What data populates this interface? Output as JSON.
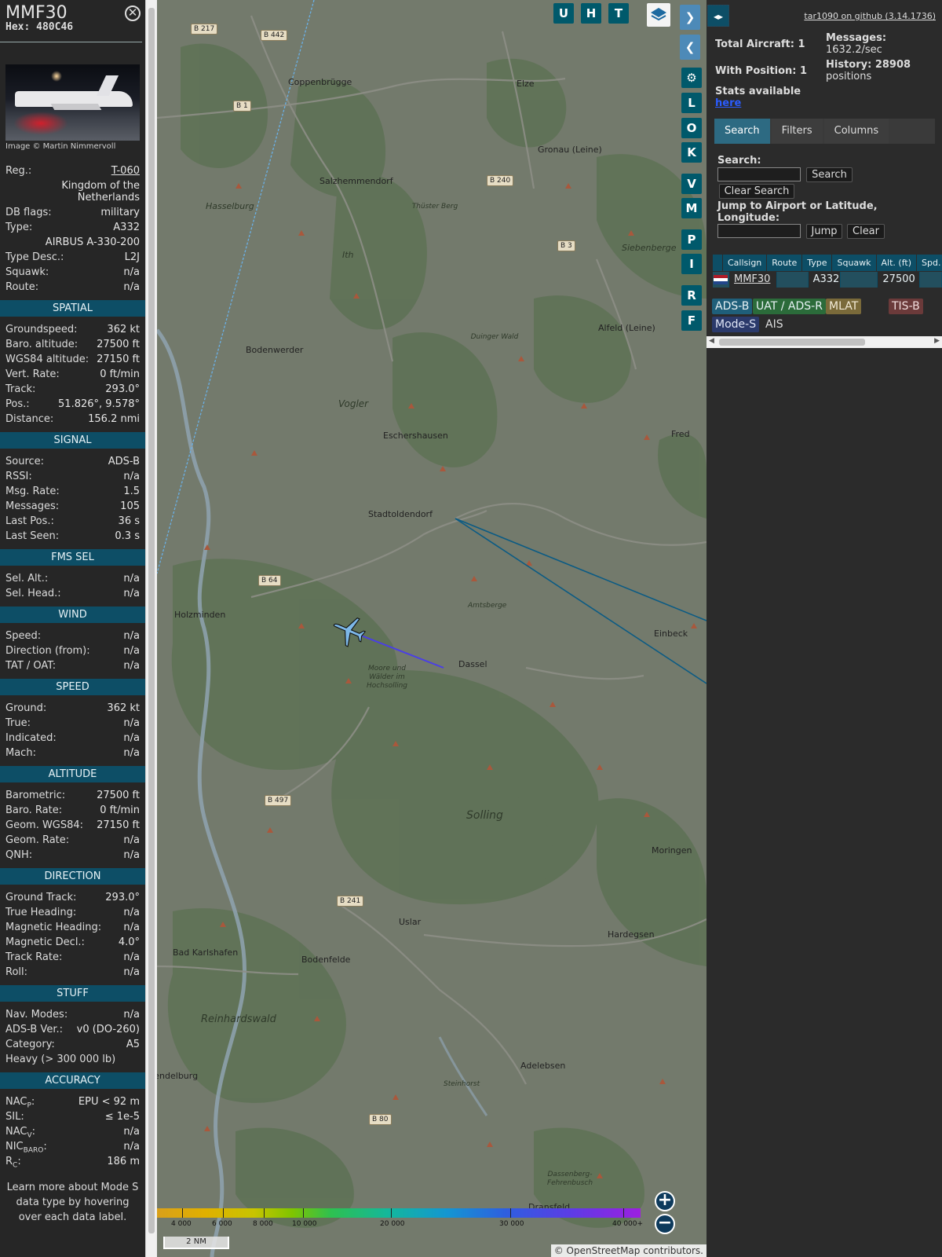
{
  "sidebar": {
    "callsign": "MMF30",
    "hex": "Hex: 480C46",
    "image_credit": "Image © Martin Nimmervoll",
    "info": [
      {
        "k": "Reg.:",
        "v": "T-060",
        "link": true
      },
      {
        "k": "",
        "v": "Kingdom of the Netherlands",
        "tall": true
      },
      {
        "k": "DB flags:",
        "v": "military"
      },
      {
        "k": "Type:",
        "v": "A332"
      },
      {
        "k": "",
        "v": "AIRBUS A-330-200"
      },
      {
        "k": "Type Desc.:",
        "v": "L2J"
      },
      {
        "k": "Squawk:",
        "v": "n/a"
      },
      {
        "k": "Route:",
        "v": "n/a"
      }
    ],
    "sections": [
      {
        "title": "SPATIAL",
        "rows": [
          {
            "k": "Groundspeed:",
            "v": "362 kt"
          },
          {
            "k": "Baro. altitude:",
            "v": "27500 ft"
          },
          {
            "k": "WGS84 altitude:",
            "v": "27150 ft"
          },
          {
            "k": "Vert. Rate:",
            "v": "0 ft/min"
          },
          {
            "k": "Track:",
            "v": "293.0°"
          },
          {
            "k": "Pos.:",
            "v": "51.826°, 9.578°"
          },
          {
            "k": "Distance:",
            "v": "156.2 nmi"
          }
        ]
      },
      {
        "title": "SIGNAL",
        "rows": [
          {
            "k": "Source:",
            "v": "ADS-B"
          },
          {
            "k": "RSSI:",
            "v": "n/a"
          },
          {
            "k": "Msg. Rate:",
            "v": "1.5"
          },
          {
            "k": "Messages:",
            "v": "105"
          },
          {
            "k": "Last Pos.:",
            "v": "36 s"
          },
          {
            "k": "Last Seen:",
            "v": "0.3 s"
          }
        ]
      },
      {
        "title": "FMS SEL",
        "rows": [
          {
            "k": "Sel. Alt.:",
            "v": "n/a"
          },
          {
            "k": "Sel. Head.:",
            "v": "n/a"
          }
        ]
      },
      {
        "title": "WIND",
        "rows": [
          {
            "k": "Speed:",
            "v": "n/a"
          },
          {
            "k": "Direction (from):",
            "v": "n/a"
          },
          {
            "k": "TAT / OAT:",
            "v": "n/a"
          }
        ]
      },
      {
        "title": "SPEED",
        "rows": [
          {
            "k": "Ground:",
            "v": "362 kt"
          },
          {
            "k": "True:",
            "v": "n/a"
          },
          {
            "k": "Indicated:",
            "v": "n/a"
          },
          {
            "k": "Mach:",
            "v": "n/a"
          }
        ]
      },
      {
        "title": "ALTITUDE",
        "rows": [
          {
            "k": "Barometric:",
            "v": "27500 ft"
          },
          {
            "k": "Baro. Rate:",
            "v": "0 ft/min"
          },
          {
            "k": "Geom. WGS84:",
            "v": "27150 ft"
          },
          {
            "k": "Geom. Rate:",
            "v": "n/a"
          },
          {
            "k": "QNH:",
            "v": "n/a"
          }
        ]
      },
      {
        "title": "DIRECTION",
        "rows": [
          {
            "k": "Ground Track:",
            "v": "293.0°"
          },
          {
            "k": "True Heading:",
            "v": "n/a"
          },
          {
            "k": "Magnetic Heading:",
            "v": "n/a"
          },
          {
            "k": "Magnetic Decl.:",
            "v": "4.0°"
          },
          {
            "k": "Track Rate:",
            "v": "n/a"
          },
          {
            "k": "Roll:",
            "v": "n/a"
          }
        ]
      },
      {
        "title": "STUFF",
        "rows": [
          {
            "k": "Nav. Modes:",
            "v": "n/a"
          },
          {
            "k": "ADS-B Ver.:",
            "v": "v0 (DO-260)"
          },
          {
            "k": "Category:",
            "v": "A5"
          },
          {
            "k": "Heavy (> 300 000 lb)",
            "v": ""
          }
        ]
      },
      {
        "title": "ACCURACY",
        "rows": [
          {
            "k": "NAC",
            "sub": "P",
            "k2": ":",
            "v": "EPU < 92 m"
          },
          {
            "k": "SIL:",
            "v": "≤ 1e-5"
          },
          {
            "k": "NAC",
            "sub": "V",
            "k2": ":",
            "v": "n/a"
          },
          {
            "k": "NIC",
            "sub": "BARO",
            "k2": ":",
            "v": "n/a"
          },
          {
            "k": "R",
            "sub": "C",
            "k2": ":",
            "v": "186 m"
          }
        ]
      }
    ],
    "learn_more": "Learn more about Mode S data type by hovering over each data label."
  },
  "map": {
    "buttons_top": [
      "U",
      "H",
      "T"
    ],
    "buttons_side": [
      "L",
      "O",
      "K",
      "V",
      "M",
      "P",
      "I",
      "R",
      "F"
    ],
    "towns": [
      {
        "name": "Coppenbrügge"
      },
      {
        "name": "Elze"
      },
      {
        "name": "Gronau (Leine)"
      },
      {
        "name": "Salzhemmendorf"
      },
      {
        "name": "Bodenwerder"
      },
      {
        "name": "Alfeld (Leine)"
      },
      {
        "name": "Eschershausen"
      },
      {
        "name": "Stadtoldendorf"
      },
      {
        "name": "Holzminden"
      },
      {
        "name": "Einbeck"
      },
      {
        "name": "Dassel"
      },
      {
        "name": "Uslar"
      },
      {
        "name": "Hardegsen"
      },
      {
        "name": "Bad Karlshafen"
      },
      {
        "name": "Bodenfelde"
      },
      {
        "name": "Moringen"
      },
      {
        "name": "Adelebsen"
      },
      {
        "name": "Dransfeld"
      },
      {
        "name": "rendelburg"
      },
      {
        "name": "Fred"
      }
    ],
    "regions": [
      {
        "name": "Hasselburg"
      },
      {
        "name": "Thüster Berg"
      },
      {
        "name": "Ith"
      },
      {
        "name": "Siebenberge"
      },
      {
        "name": "Duinger Wald"
      },
      {
        "name": "Vogler"
      },
      {
        "name": "Amtsberge"
      },
      {
        "name": "Moore und Wälder im Hochsolling"
      },
      {
        "name": "Solling"
      },
      {
        "name": "Reinhardswald"
      },
      {
        "name": "Steinhorst"
      },
      {
        "name": "Dassenberg-Fehrenbusch"
      }
    ],
    "roads": [
      "B 217",
      "B 442",
      "B 1",
      "B 240",
      "B 3",
      "B 64",
      "B 497",
      "B 241",
      "B 80"
    ],
    "altitude_scale": [
      "4 000",
      "6 000",
      "8 000",
      "10 000",
      "20 000",
      "30 000",
      "40 000+"
    ],
    "scale_label": "2 NM",
    "attribution": "© OpenStreetMap contributors.",
    "attribution_link": "OpenStreetMap"
  },
  "panel": {
    "toggle_icon": "◂▸",
    "github": "tar1090 on github (3.14.1736)",
    "total_aircraft": "Total Aircraft: 1",
    "with_position": "With Position: 1",
    "messages_label": "Messages:",
    "messages_value": "1632.2/sec",
    "history_label": "History: 28908",
    "history_value": "positions",
    "stats_text": "Stats available",
    "stats_link": "here",
    "tabs": [
      "Search",
      "Filters",
      "Columns"
    ],
    "search_label": "Search:",
    "search_button": "Search",
    "clear_search_button": "Clear Search",
    "jump_label": "Jump to Airport or Latitude, Longitude:",
    "jump_button": "Jump",
    "clear_button": "Clear",
    "table": {
      "headers": [
        "Callsign",
        "Route",
        "Type",
        "Squawk",
        "Alt. (ft)",
        "Spd."
      ],
      "row": {
        "callsign": "MMF30",
        "route": "",
        "type": "A332",
        "squawk": "",
        "alt": "27500",
        "spd": ""
      }
    },
    "sources": [
      {
        "label": "ADS-B",
        "bg": "#1f5f7a",
        "fg": "#e8f2f5"
      },
      {
        "label": "UAT / ADS-R",
        "bg": "#2b6b3a",
        "fg": "#e8f2f5"
      },
      {
        "label": "MLAT",
        "bg": "#7a6a3a",
        "fg": "#f2ead6"
      },
      {
        "label": "TIS-B",
        "bg": "#6b3a3a",
        "fg": "#f2dede"
      },
      {
        "label": "Mode-S",
        "bg": "#2b3a6b",
        "fg": "#e0e6f7"
      },
      {
        "label": "AIS",
        "bg": "transparent",
        "fg": "#dddddd"
      }
    ]
  }
}
